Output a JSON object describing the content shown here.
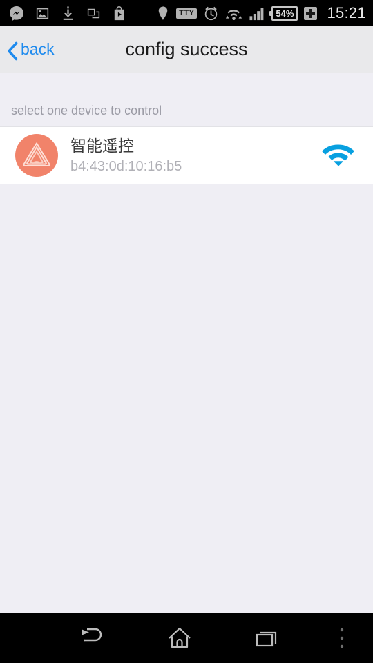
{
  "status_bar": {
    "time": "15:21",
    "battery_percent": "54%",
    "tty_label": "TTY",
    "left_icons": [
      {
        "name": "messenger-icon",
        "label": "Messenger"
      },
      {
        "name": "photo-icon",
        "label": "Photo"
      },
      {
        "name": "download-icon",
        "label": "Download"
      },
      {
        "name": "screenshot-icon",
        "label": "Screenshot"
      },
      {
        "name": "play-store-icon",
        "label": "Play Store"
      }
    ],
    "right_icons": [
      {
        "name": "location-pin-icon",
        "label": "Location"
      },
      {
        "name": "tty-icon",
        "label": "TTY"
      },
      {
        "name": "alarm-clock-icon",
        "label": "Alarm"
      },
      {
        "name": "wifi-transfer-icon",
        "label": "Wi-Fi"
      },
      {
        "name": "signal-bars-icon",
        "label": "Signal"
      },
      {
        "name": "battery-icon",
        "label": "Battery"
      },
      {
        "name": "charging-plus-icon",
        "label": "Charging"
      }
    ]
  },
  "header": {
    "back_label": "back",
    "title": "config success",
    "accent_color": "#1d8aee"
  },
  "content": {
    "hint": "select one device to control",
    "devices": [
      {
        "name": "智能遥控",
        "mac": "b4:43:0d:10:16:b5",
        "avatar_color": "#f1836a",
        "wifi_color": "#08a0e0",
        "wifi_state": "connected"
      }
    ]
  },
  "nav_bar": {
    "buttons": [
      {
        "name": "nav-back-button",
        "label": "Back"
      },
      {
        "name": "nav-home-button",
        "label": "Home"
      },
      {
        "name": "nav-recents-button",
        "label": "Recents"
      },
      {
        "name": "nav-menu-button",
        "label": "Menu"
      }
    ]
  }
}
